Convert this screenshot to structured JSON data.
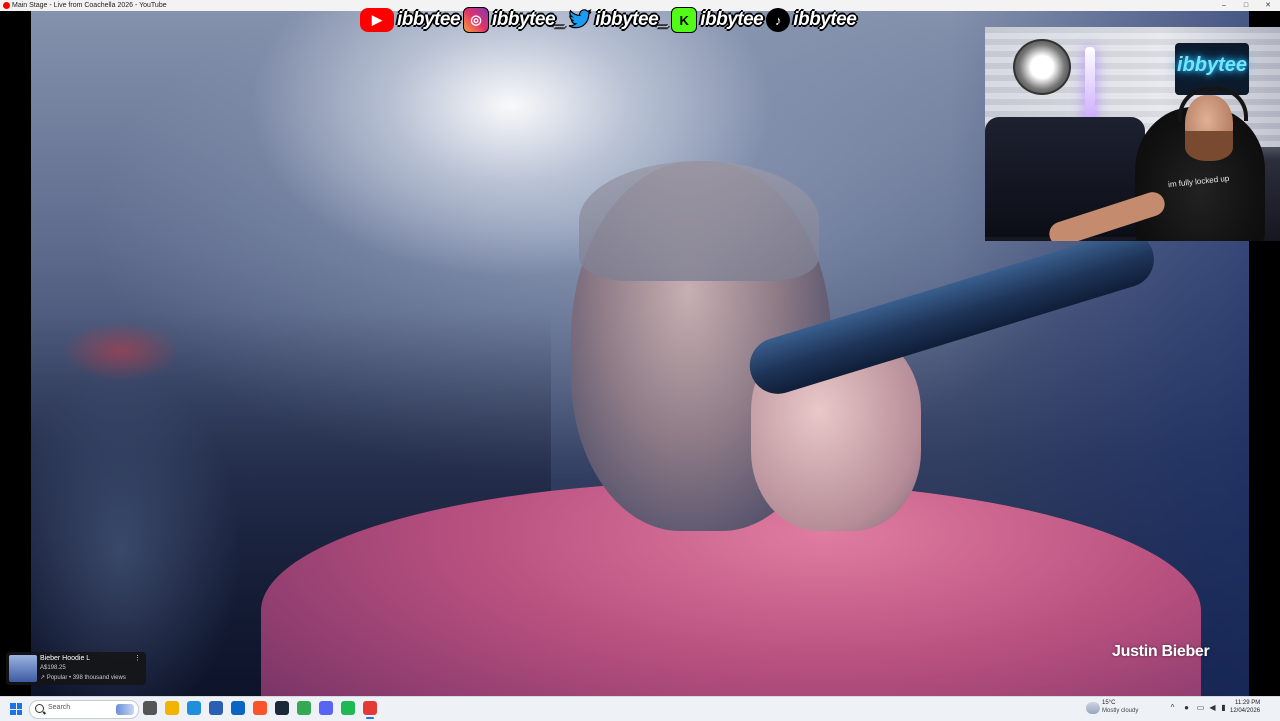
{
  "window": {
    "title": "Main Stage - Live from Coachella 2026 - YouTube",
    "minimize": "–",
    "maximize": "□",
    "close": "✕"
  },
  "social": [
    {
      "platform": "youtube",
      "icon": "youtube-icon",
      "glyph": "▶",
      "handle": "ibbytee"
    },
    {
      "platform": "instagram",
      "icon": "instagram-icon",
      "glyph": "◎",
      "handle": "ibbytee_"
    },
    {
      "platform": "twitter",
      "icon": "twitter-bird-icon",
      "glyph": "🐦",
      "handle": "ibbytee_"
    },
    {
      "platform": "kick",
      "icon": "kick-icon",
      "glyph": "K",
      "handle": "ibbytee"
    },
    {
      "platform": "tiktok",
      "icon": "tiktok-icon",
      "glyph": "♪",
      "handle": "ibbytee"
    }
  ],
  "video": {
    "caption": "Justin Bieber"
  },
  "webcam": {
    "neon_sign": "ibbytee",
    "shirt_text": "im fully locked up"
  },
  "ad": {
    "product": "Bieber Hoodie L",
    "price": "A$198.25",
    "meta": "↗ Popular • 398 thousand views",
    "more": "⋮"
  },
  "taskbar": {
    "search_placeholder": "Search",
    "weather_temp": "15°C",
    "weather_desc": "Mostly cloudy",
    "time": "11:29 PM",
    "date": "12/04/2026",
    "apps": [
      {
        "name": "task-view-icon",
        "color": "#555555"
      },
      {
        "name": "file-explorer-icon",
        "color": "#f2b400"
      },
      {
        "name": "edge-browser-icon",
        "color": "#1f8fd9"
      },
      {
        "name": "store-icon",
        "color": "#2b5fb3"
      },
      {
        "name": "outlook-icon",
        "color": "#0a64c2"
      },
      {
        "name": "brave-browser-icon",
        "color": "#fb542b"
      },
      {
        "name": "steam-icon",
        "color": "#1b2838"
      },
      {
        "name": "chrome-icon",
        "color": "#34a853"
      },
      {
        "name": "discord-icon",
        "color": "#5865f2"
      },
      {
        "name": "spotify-icon",
        "color": "#1db954"
      },
      {
        "name": "obs-youtube-icon",
        "color": "#e53935"
      }
    ]
  }
}
